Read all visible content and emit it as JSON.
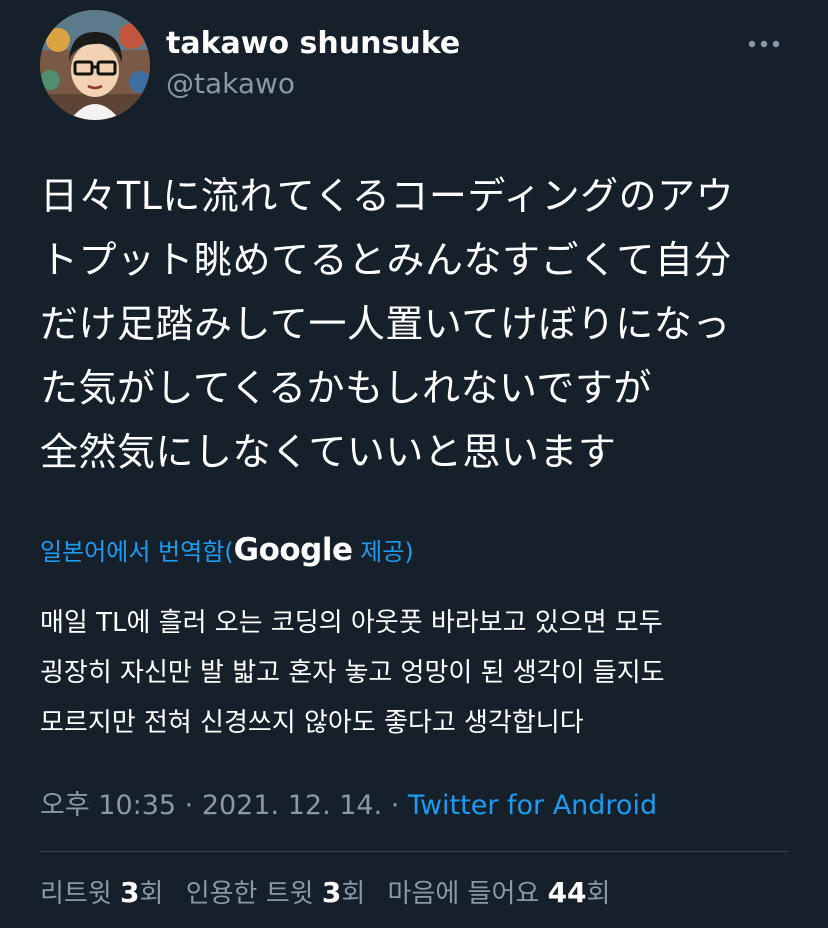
{
  "user": {
    "display_name": "takawo shunsuke",
    "handle": "@takawo"
  },
  "tweet": {
    "text": "日々TLに流れてくるコーディングのアウ\nトプット眺めてるとみんなすごくて自分\nだけ足踏みして一人置いてけぼりになっ\nた気がしてくるかもしれないですが\n全然気にしなくていいと思います"
  },
  "translate": {
    "label": "일본어에서 번역함(",
    "provider": "Google",
    "suffix": " 제공)"
  },
  "translation": {
    "text": "매일 TL에 흘러 오는 코딩의 아웃풋 바라보고 있으면 모두\n굉장히 자신만 발 밟고 혼자 놓고 엉망이 된 생각이 들지도\n모르지만 전혀 신경쓰지 않아도 좋다고 생각합니다"
  },
  "meta": {
    "time": "오후 10:35",
    "sep1": " · ",
    "date": "2021. 12. 14.",
    "sep2": " · ",
    "source": "Twitter for Android"
  },
  "stats": {
    "retweets_label": "리트윗 ",
    "retweets_count": "3",
    "retweets_unit": "회",
    "quotes_label": "인용한 트윗 ",
    "quotes_count": "3",
    "quotes_unit": "회",
    "likes_label": "마음에 들어요 ",
    "likes_count": "44",
    "likes_unit": "회"
  },
  "icons": {
    "more": "more-dots-icon",
    "avatar": "avatar-illustration"
  },
  "colors": {
    "background": "#15202b",
    "accent": "#1d9bf0",
    "secondary_text": "#8b98a5",
    "divider": "#38444d"
  }
}
